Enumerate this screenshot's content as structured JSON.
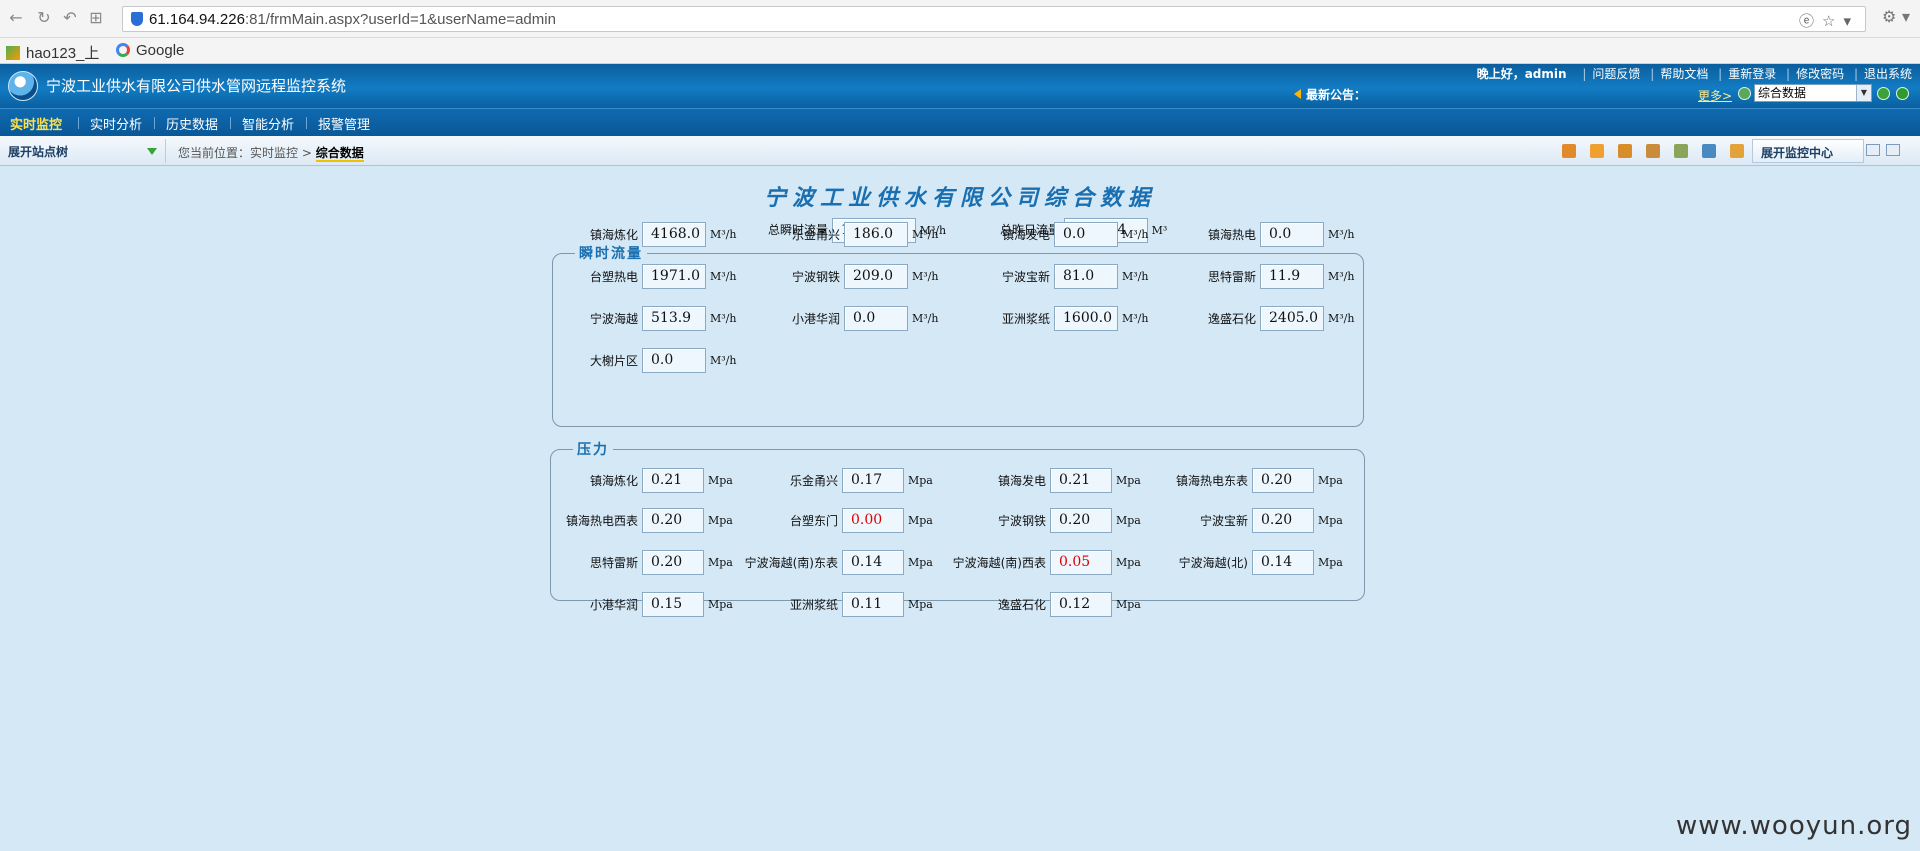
{
  "browser": {
    "url_host": "61.164.94.226",
    "url_rest": ":81/frmMain.aspx?userId=1&userName=admin",
    "bookmarks": [
      "hao123_上",
      "Google"
    ]
  },
  "header": {
    "title": "宁波工业供水有限公司供水管网远程监控系统",
    "greeting": "晚上好，admin",
    "links": [
      "问题反馈",
      "帮助文档",
      "重新登录",
      "修改密码",
      "退出系统"
    ],
    "notice_label": "最新公告：",
    "more_label": "更多>",
    "page_select": "综合数据"
  },
  "menu": {
    "items": [
      "实时监控",
      "实时分析",
      "历史数据",
      "智能分析",
      "报警管理"
    ]
  },
  "toolbar": {
    "tree_toggle": "展开站点树",
    "crumb_prefix": "您当前位置：实时监控 >",
    "crumb_current": "综合数据",
    "monitor_center": "展开监控中心"
  },
  "main": {
    "title": "宁波工业供水有限公司综合数据",
    "total_instant_label": "总瞬时流量",
    "total_instant_value": "11146",
    "total_instant_unit": "M³/h",
    "total_yesterday_label": "总昨日流量",
    "total_yesterday_value": "279704",
    "total_yesterday_unit": "M³"
  },
  "flow": {
    "legend": "瞬时流量",
    "unit": "M³/h",
    "items": [
      {
        "label": "镇海炼化",
        "value": "4168.0"
      },
      {
        "label": "乐金甬兴",
        "value": "186.0"
      },
      {
        "label": "镇海发电",
        "value": "0.0"
      },
      {
        "label": "镇海热电",
        "value": "0.0"
      },
      {
        "label": "台塑热电",
        "value": "1971.0"
      },
      {
        "label": "宁波钢铁",
        "value": "209.0"
      },
      {
        "label": "宁波宝新",
        "value": "81.0"
      },
      {
        "label": "思特雷斯",
        "value": "11.9"
      },
      {
        "label": "宁波海越",
        "value": "513.9"
      },
      {
        "label": "小港华润",
        "value": "0.0"
      },
      {
        "label": "亚洲浆纸",
        "value": "1600.0"
      },
      {
        "label": "逸盛石化",
        "value": "2405.0"
      },
      {
        "label": "大榭片区",
        "value": "0.0"
      }
    ]
  },
  "pressure": {
    "legend": "压力",
    "unit": "Mpa",
    "items": [
      {
        "label": "镇海炼化",
        "value": "0.21"
      },
      {
        "label": "乐金甬兴",
        "value": "0.17"
      },
      {
        "label": "镇海发电",
        "value": "0.21"
      },
      {
        "label": "镇海热电东表",
        "value": "0.20"
      },
      {
        "label": "镇海热电西表",
        "value": "0.20"
      },
      {
        "label": "台塑东门",
        "value": "0.00"
      },
      {
        "label": "宁波钢铁",
        "value": "0.20"
      },
      {
        "label": "宁波宝新",
        "value": "0.20"
      },
      {
        "label": "思特雷斯",
        "value": "0.20"
      },
      {
        "label": "宁波海越(南)东表",
        "value": "0.14"
      },
      {
        "label": "宁波海越(南)西表",
        "value": "0.05"
      },
      {
        "label": "宁波海越(北)",
        "value": "0.14"
      },
      {
        "label": "小港华润",
        "value": "0.15"
      },
      {
        "label": "亚洲浆纸",
        "value": "0.11"
      },
      {
        "label": "逸盛石化",
        "value": "0.12"
      }
    ]
  },
  "watermark": "www.wooyun.org",
  "colors": {
    "alarm": "#e00000",
    "accent": "#1a6fb0"
  }
}
